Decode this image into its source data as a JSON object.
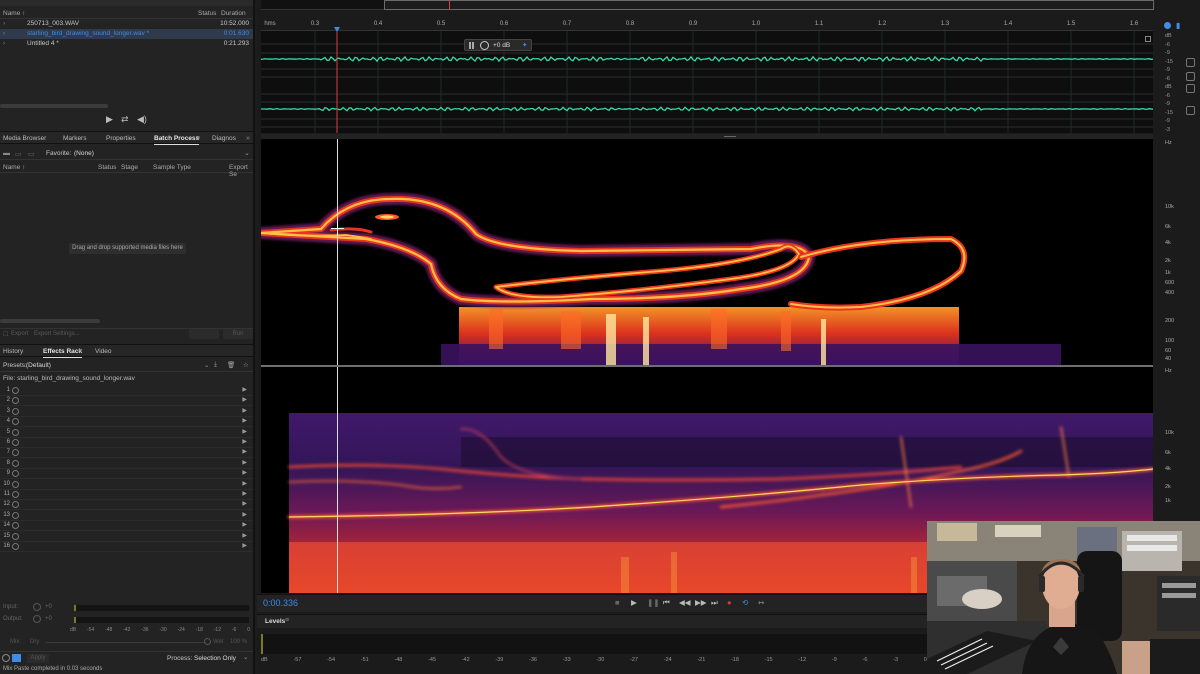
{
  "files_panel": {
    "columns": {
      "name": "Name ↑",
      "status": "Status",
      "duration": "Duration"
    },
    "files": [
      {
        "name": "250713_003.WAV",
        "duration": "10:52.000",
        "selected": false
      },
      {
        "name": "starling_bird_drawing_sound_longer.wav *",
        "duration": "0:01.630",
        "selected": true
      },
      {
        "name": "Untitled 4 *",
        "duration": "0:21.293",
        "selected": false
      }
    ]
  },
  "panel_tabs": {
    "media_browser": "Media Browser",
    "markers": "Markers",
    "properties": "Properties",
    "batch_process": "Batch Process",
    "diagnostics": "Diagnos"
  },
  "batch": {
    "favorite_label": "Favorite:",
    "favorite_value": "(None)",
    "columns": {
      "name": "Name ↑",
      "status": "Status",
      "stage": "Stage",
      "sample_type": "Sample Type",
      "export": "Export Se"
    },
    "drop_hint": "Drag and drop supported media files here",
    "footer": {
      "export": "Export",
      "export_settings": "Export Settings...",
      "run": "Run"
    }
  },
  "rack_tabs": {
    "history": "History",
    "effects_rack": "Effects Rack",
    "video": "Video"
  },
  "effects_rack": {
    "presets_label": "Presets:",
    "presets_value": "(Default)",
    "file_label": "File: starling_bird_drawing_sound_longer.wav",
    "slots": [
      "1",
      "2",
      "3",
      "4",
      "5",
      "6",
      "7",
      "8",
      "9",
      "10",
      "11",
      "12",
      "13",
      "14",
      "15",
      "16"
    ],
    "input_label": "Input:",
    "output_label": "Output:",
    "input_value": "+0",
    "output_value": "+0",
    "mix_label": "Mix:",
    "mix_mode": "Dry",
    "wet_label": "Wet",
    "wet_value": "100 %",
    "meter_scale": [
      "dB",
      "-54",
      "-48",
      "-42",
      "-36",
      "-30",
      "-24",
      "-18",
      "-12",
      "-6",
      "0"
    ],
    "bypass_label": "Apply",
    "process_label": "Process:",
    "process_value": "Selection Only"
  },
  "status_bar": {
    "message": "Mix Paste completed in 0.03 seconds"
  },
  "editor": {
    "ruler_unit": "hms",
    "ruler_ticks": [
      "0.3",
      "0.4",
      "0.5",
      "0.6",
      "0.7",
      "0.8",
      "0.9",
      "1.0",
      "1.1",
      "1.2",
      "1.3",
      "1.4",
      "1.5",
      "1.6"
    ],
    "hud_gain": "+0 dB",
    "db_scale_top": [
      "dB",
      "-6",
      "-9",
      "-15",
      "-9",
      "-6"
    ],
    "db_scale_bottom": [
      "dB",
      "-6",
      "-9",
      "-15",
      "-9",
      "-3"
    ],
    "hz_scale_top": [
      "Hz",
      "10k",
      "6k",
      "4k",
      "2k",
      "1k",
      "600",
      "400",
      "200",
      "100",
      "60",
      "40"
    ],
    "hz_scale_bottom": [
      "Hz",
      "10k",
      "6k",
      "4k",
      "2k",
      "1k"
    ],
    "timecode": "0:00.336",
    "levels_label": "Levels",
    "levels_scale": [
      "dB",
      "-57",
      "-54",
      "-51",
      "-48",
      "-45",
      "-42",
      "-39",
      "-36",
      "-33",
      "-30",
      "-27",
      "-24",
      "-21",
      "-18",
      "-15",
      "-12",
      "-9",
      "-6",
      "-3",
      "0"
    ],
    "colors": {
      "accent": "#3f8de6",
      "waveform": "#38d9a9",
      "playhead": "#e03a3a"
    }
  }
}
